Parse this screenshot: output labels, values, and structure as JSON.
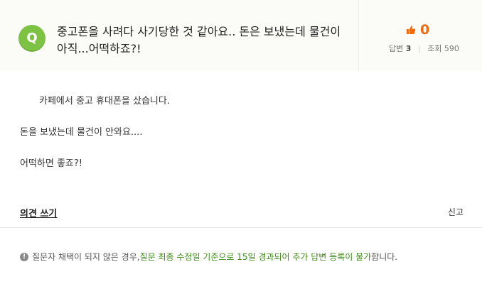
{
  "question": {
    "badge": "Q",
    "title": "중고폰을 사려다 사기당한 것 같아요.. 돈은 보냈는데 물건이 아직...어떡하죠?!"
  },
  "stats": {
    "like_count": "0",
    "answers_label": "답변",
    "answers_value": "3",
    "views_label": "조회",
    "views_value": "590",
    "like_color": "#f06a0f"
  },
  "body": {
    "line1": "카페에서 중고 휴대폰을 샀습니다.",
    "line2": "돈을 보냈는데 물건이 안와요....",
    "line3": "어떡하면 좋죠?!"
  },
  "actions": {
    "write_opinion": "의견 쓰기",
    "report": "신고"
  },
  "notice": {
    "prefix": "질문자 채택이 되지 않은 경우, ",
    "highlight": "질문 최종 수정일 기준으로 15일 경과되어 추가 답변 등록이 불가",
    "suffix": "합니다.",
    "icon": "warning-icon"
  },
  "colors": {
    "badge_green": "#7dc243",
    "notice_green": "#3c8a16",
    "header_bg": "#fbfbf7"
  }
}
